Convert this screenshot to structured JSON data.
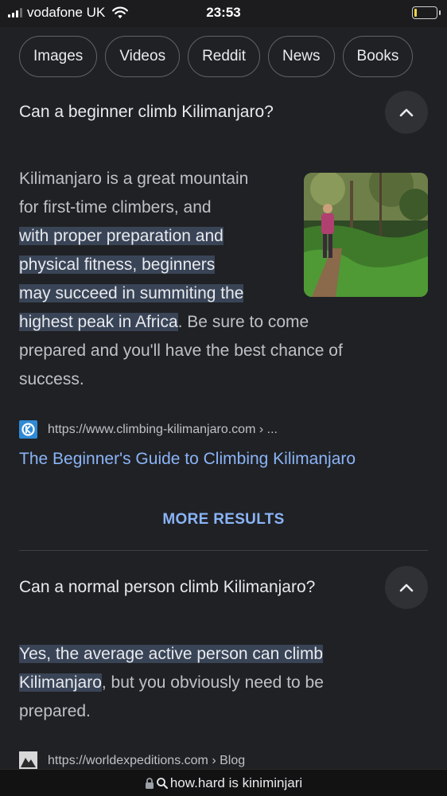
{
  "status_bar": {
    "carrier": "vodafone UK",
    "time": "23:53",
    "battery_level": 0.1,
    "battery_color": "#f5d442"
  },
  "chips": [
    "Images",
    "Videos",
    "Reddit",
    "News",
    "Books"
  ],
  "faq1": {
    "question": "Can a beginner climb Kilimanjaro?",
    "answer_lines": [
      {
        "plain": "Kilimanjaro is a great mountain"
      },
      {
        "plain": "for first-time climbers, and"
      },
      {
        "hl": "with proper preparation and"
      },
      {
        "hl": "physical fitness, beginners"
      },
      {
        "hl": "may succeed in summiting the"
      },
      {
        "hl": "highest peak in Africa",
        "plain": ". Be sure to come"
      },
      {
        "plain": "prepared and you'll have the best chance of"
      },
      {
        "plain": "success."
      }
    ],
    "source_url": "https://www.climbing-kilimanjaro.com › ...",
    "link_title": "The Beginner's Guide to Climbing Kilimanjaro",
    "favicon_icon": "climbing-kilimanjaro-logo-icon",
    "thumbnail_icon": "hiker-on-trail-image"
  },
  "more_results": "MORE RESULTS",
  "faq2": {
    "question": "Can a normal person climb Kilimanjaro?",
    "answer_lines": [
      {
        "hl": "Yes, the average active person can climb"
      },
      {
        "hl": "Kilimanjaro",
        "plain": ", but you obviously need to be"
      },
      {
        "plain": "prepared."
      }
    ],
    "source_url": "https://worldexpeditions.com › Blog"
  },
  "url_bar": {
    "query": "how.hard is kiniminjari",
    "lock_icon": "lock-icon",
    "search_icon": "search-icon"
  },
  "colors": {
    "background": "#202124",
    "highlight": "#394457",
    "link": "#8ab4f8"
  }
}
